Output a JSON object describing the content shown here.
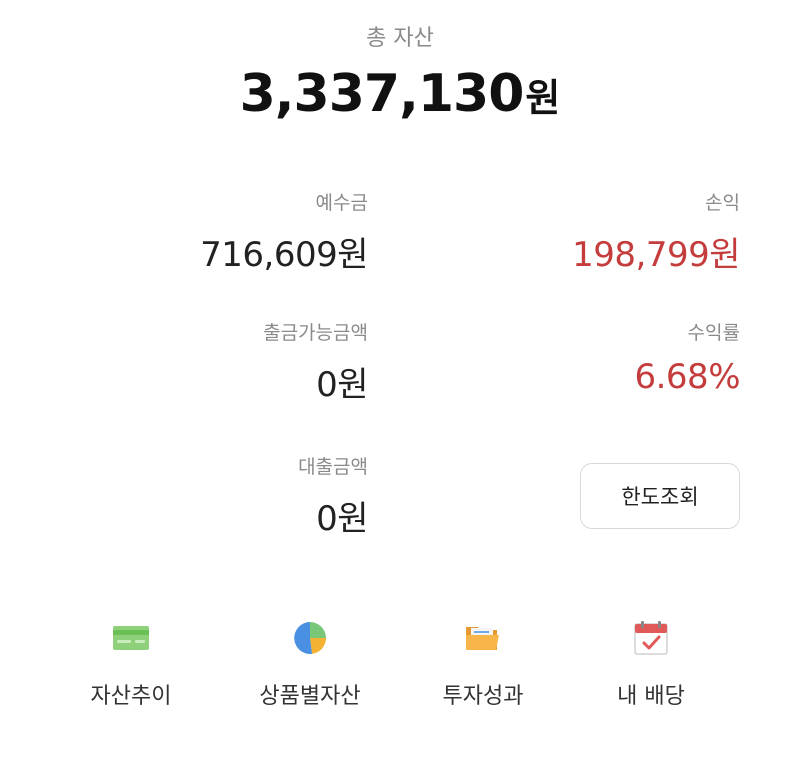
{
  "summary": {
    "total_label": "총 자산",
    "total_amount": "3,337,130",
    "currency_unit": "원"
  },
  "metrics": {
    "deposit": {
      "label": "예수금",
      "value": "716,609원"
    },
    "profit": {
      "label": "손익",
      "value": "198,799원",
      "color": "#c43c3c"
    },
    "withdrawable": {
      "label": "출금가능금액",
      "value": "0원"
    },
    "return_rate": {
      "label": "수익률",
      "value": "6.68%",
      "color": "#c43c3c"
    },
    "loan": {
      "label": "대출금액",
      "value": "0원"
    }
  },
  "limit_button": {
    "label": "한도조회"
  },
  "menu": [
    {
      "label": "자산추이",
      "icon": "credit-card-icon"
    },
    {
      "label": "상품별자산",
      "icon": "pie-chart-icon"
    },
    {
      "label": "투자성과",
      "icon": "folder-icon"
    },
    {
      "label": "내 배당",
      "icon": "calendar-icon"
    }
  ]
}
